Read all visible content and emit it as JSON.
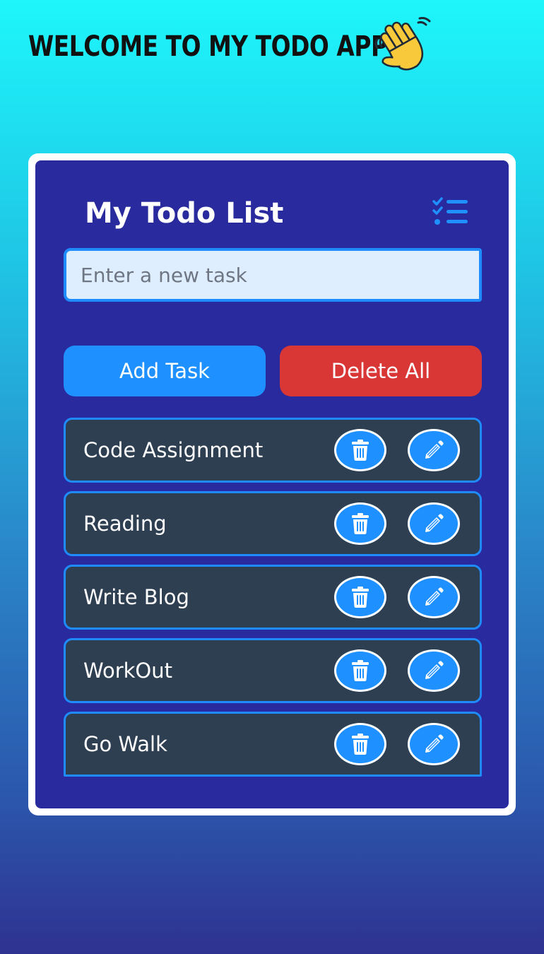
{
  "header": {
    "welcome_text": "Welcome to my todo app",
    "wave_icon": "waving-hand-icon"
  },
  "card": {
    "title": "My Todo List",
    "title_icon": "checklist-icon",
    "input": {
      "placeholder": "Enter a new task",
      "value": ""
    },
    "buttons": {
      "add_label": "Add Task",
      "delete_all_label": "Delete All"
    },
    "tasks": [
      {
        "text": "Code Assignment",
        "delete_icon": "trash-icon",
        "edit_icon": "pencil-icon"
      },
      {
        "text": "Reading",
        "delete_icon": "trash-icon",
        "edit_icon": "pencil-icon"
      },
      {
        "text": "Write Blog",
        "delete_icon": "trash-icon",
        "edit_icon": "pencil-icon"
      },
      {
        "text": "WorkOut",
        "delete_icon": "trash-icon",
        "edit_icon": "pencil-icon"
      },
      {
        "text": "Go Walk",
        "delete_icon": "trash-icon",
        "edit_icon": "pencil-icon"
      }
    ]
  },
  "colors": {
    "card_background": "#292a9d",
    "accent_blue": "#1e90ff",
    "danger_red": "#d93636",
    "task_background": "#2e3f52",
    "input_background": "#dfeefe"
  }
}
